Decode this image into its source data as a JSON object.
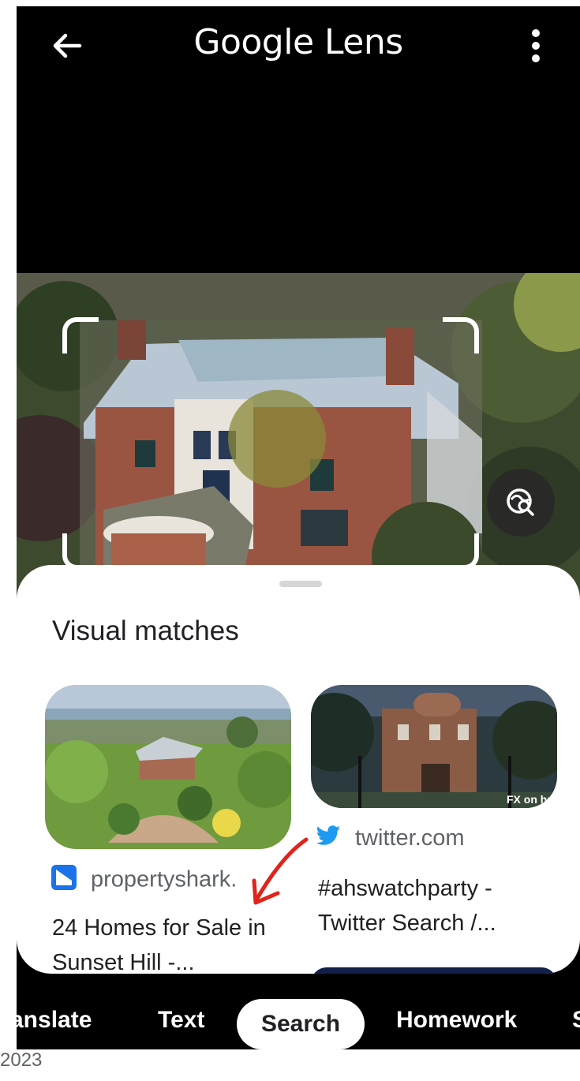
{
  "app": {
    "title": "Google Lens"
  },
  "sheet": {
    "title": "Visual matches",
    "results": [
      {
        "source": "propertyshark.",
        "title": "24 Homes for Sale in Sunset Hill -..."
      },
      {
        "source": "twitter.com",
        "title": "#ahswatchparty - Twitter Search /..."
      }
    ],
    "thumb_watermark": "FX on hulu"
  },
  "modes": [
    "anslate",
    "Text",
    "Search",
    "Homework",
    "S"
  ],
  "footer": {
    "text": "2023"
  },
  "colors": {
    "accent_arrow": "#e0231b",
    "twitter_blue": "#1d9bf0",
    "propertyshark_blue": "#1a73e8"
  },
  "icons": [
    "back-arrow-icon",
    "more-vert-icon",
    "lens-search-icon",
    "propertyshark-icon",
    "twitter-icon"
  ]
}
